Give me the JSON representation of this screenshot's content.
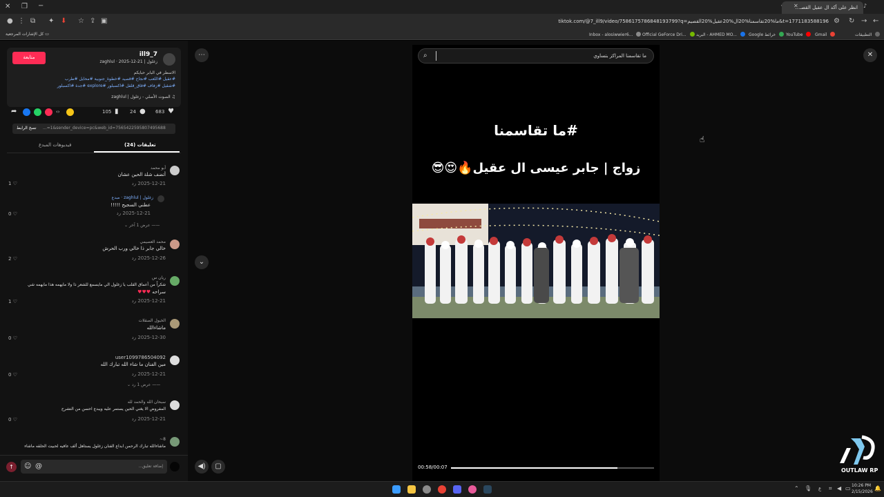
{
  "browser": {
    "tab_title": "انظر على أكد ال عقيل القصـ...",
    "url": "tiktok.com/@7_ill9/video/7586175786848193799?q=ما%20تقاسمنا%20ال%20عقيل%20القصيم&t=1771183588196",
    "bookmarks": [
      {
        "label": "التطبيقات",
        "color": "#6a6a6a"
      },
      {
        "label": "Gmail",
        "color": "#e94235"
      },
      {
        "label": "YouTube",
        "color": "#ff0000"
      },
      {
        "label": "Google خرائط",
        "color": "#34a853"
      },
      {
        "label": "البريد - AHMED MO...",
        "color": "#1a73e8"
      },
      {
        "label": "Official GeForce Dri...",
        "color": "#76b900"
      },
      {
        "label": "Inbox - alosiwwier6...",
        "color": "#8a8a8a"
      }
    ],
    "all_bookmarks": "كل الإشارات المرجعية"
  },
  "post": {
    "username": "ill9_7",
    "display_name": "زغلول | zaghlul ·",
    "date": "2025-12-21",
    "follow_label": "متابعة",
    "caption_line1": "الاسطر في البابر حبايكم",
    "hashtags1": "#عقيل #اللعب #نجاح #قصيد #خطوة_جنوبية #محايل #طرب",
    "hashtags2": "#شقيل #زفاف #قاق_قلقل #اكسبلور #explore #جدة #اكسبلور",
    "sound": "الصوت الأصلي - زغلول | zaghlul",
    "likes": "683",
    "comments": "24",
    "saves": "105",
    "link_label": "نسخ الرابط",
    "link_value": "...=1&sender_device=pc&web_id=7565422595807495688",
    "tab_comments": "تعليقات (24)",
    "tab_creator": "فيديوهات المبدع"
  },
  "comments": [
    {
      "name": "أبو محمد",
      "text": "أتضف شلة الحين عشان",
      "date": "2025-12-21",
      "reply": "رد",
      "likes": "1"
    },
    {
      "name": "زغلول | zaghlul · مبدع",
      "text": "عطني السجيح !!!!!",
      "date": "2025-12-21",
      "reply": "رد",
      "likes": "0",
      "more": "عرض 1 آخر"
    },
    {
      "name": "محمد العصيمي",
      "text": "خالي جابر ذا خالي ورب الحرش",
      "date": "2025-12-26",
      "reply": "رد",
      "likes": "2"
    },
    {
      "name": "ريان س",
      "text": "شكراً من أعماق القلب يا زغلول الي مايسمع للشعر ذا ولا مايهمه هذا مايهمه شي",
      "text2": "سراحه",
      "date": "2025-12-21",
      "reply": "رد",
      "likes": "1"
    },
    {
      "name": "الخيول الصقلات",
      "text": "ماشاءالله",
      "date": "2025-12-30",
      "reply": "رد",
      "likes": "0"
    },
    {
      "name": "user1099786504092",
      "text": "مين الفنان ما شاء الله تبارك الله",
      "date": "2025-12-21",
      "reply": "رد",
      "likes": "0",
      "more": "عرض 1 رد"
    },
    {
      "name": "سبحان الله والحمد لله",
      "text": "المفروض الا يغني الحين يستمر عليه ويبدع احسن من التشرح",
      "date": "2025-12-21",
      "reply": "رد",
      "likes": "0"
    },
    {
      "name": "8~",
      "text": "ماشاءالله تبارك الرحمن ابداع الفنان زغلول يستاهل ألف عافيه لحبيت الحلقه ماشاء",
      "date": "",
      "reply": "",
      "likes": ""
    }
  ],
  "comment_input": {
    "placeholder": "إضافة تعليق..."
  },
  "video": {
    "search_text": "ما تقاسمنا المراكز بتساوي",
    "caption_line1": "#ما تقاسمنا",
    "caption_line2": "زواج | جابر عيسى ال عقيل🔥😍😎",
    "time": "00:58/00:07",
    "progress": 0.82
  },
  "watermark": {
    "text": "OUTLAW RP"
  },
  "taskbar": {
    "time": "10:26 PM",
    "date": "2/15/2026"
  },
  "colors": {
    "accent": "#fe2c55",
    "link": "#7fb1ff"
  }
}
